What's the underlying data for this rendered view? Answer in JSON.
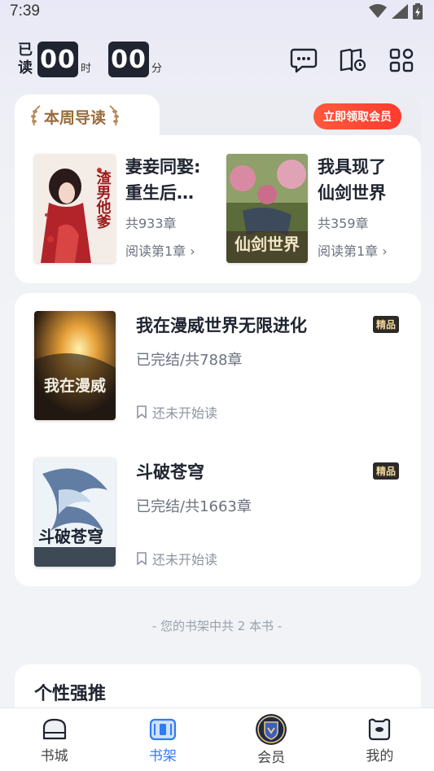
{
  "status_bar": {
    "time": "7:39"
  },
  "timer": {
    "label_1": "已",
    "label_2": "读",
    "hours": "00",
    "hours_unit": "时",
    "minutes": "00",
    "minutes_unit": "分"
  },
  "top_icons": [
    "message-icon",
    "reading-history-icon",
    "apps-grid-icon"
  ],
  "weekly_guide": {
    "title": "本周导读",
    "vip_button": "立即领取会员",
    "books": [
      {
        "title_line1": "妻妾同娶:",
        "title_line2": "重生后…",
        "chapters": "共933章",
        "read_link": "阅读第1章",
        "cover_text": "渣男他爹"
      },
      {
        "title_line1": "我具现了",
        "title_line2": "仙剑世界",
        "chapters": "共359章",
        "read_link": "阅读第1章",
        "cover_text": "仙剑世界"
      }
    ]
  },
  "shelf": {
    "books": [
      {
        "title": "我在漫威世界无限进化",
        "badge": "精品",
        "status": "已完结/共788章",
        "progress": "还未开始读",
        "cover_text": "我在漫威"
      },
      {
        "title": "斗破苍穹",
        "badge": "精品",
        "status": "已完结/共1663章",
        "progress": "还未开始读",
        "cover_text": "斗破苍穹"
      }
    ],
    "count_text": "- 您的书架中共 2 本书 -"
  },
  "recommend": {
    "title": "个性强推"
  },
  "tabbar": {
    "active": "书架",
    "items": [
      {
        "label": "书城",
        "icon": "bookstore-icon"
      },
      {
        "label": "书架",
        "icon": "bookshelf-icon"
      },
      {
        "label": "会员",
        "icon": "vip-shield-icon"
      },
      {
        "label": "我的",
        "icon": "profile-icon"
      }
    ]
  },
  "colors": {
    "accent": "#2f7cf6",
    "vip_button": "#ff4a34",
    "guide_title": "#9a6b3c",
    "timer_box": "#1f2430",
    "badge_bg": "#2c2a28",
    "badge_text": "#f2d59b"
  }
}
